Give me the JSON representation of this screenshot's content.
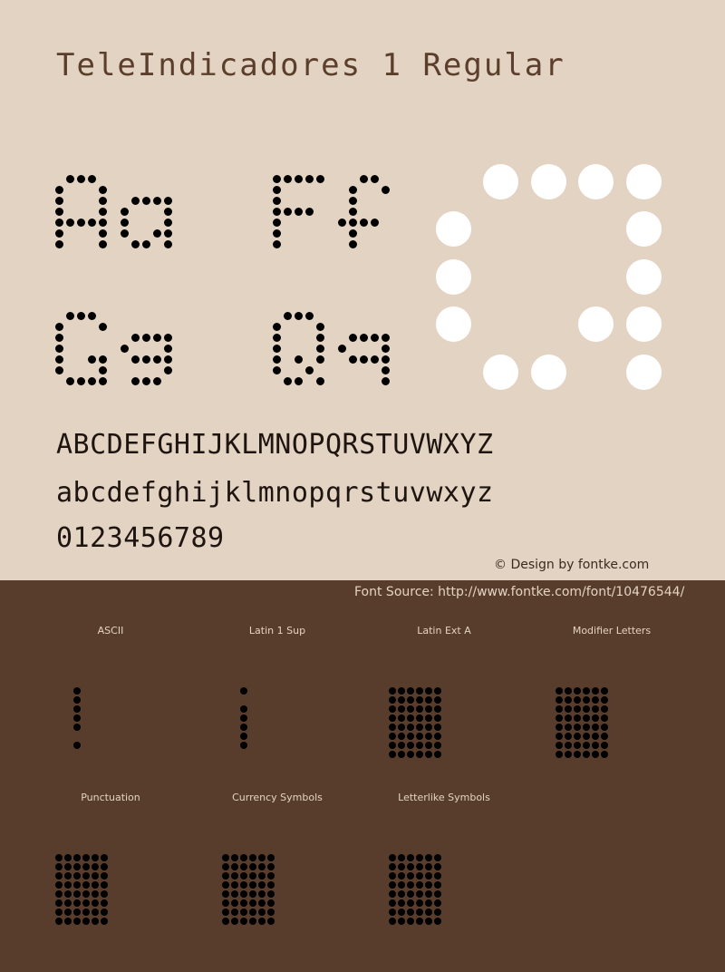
{
  "title": "TeleIndicadores 1 Regular",
  "colors": {
    "background_top": "#e3d3c2",
    "background_bottom": "#583d2c",
    "ink": "#000000",
    "title_ink": "#5b3e2c",
    "highlight_dots": "#ffffff"
  },
  "samples": [
    {
      "name": "sample-Aa",
      "text": "Aa"
    },
    {
      "name": "sample-Ff",
      "text": "Ff"
    },
    {
      "name": "sample-Gg",
      "text": "Gg"
    },
    {
      "name": "sample-Qq",
      "text": "Qq"
    },
    {
      "name": "sample-large-a",
      "text": "a"
    }
  ],
  "alphabet": {
    "uppercase": "ABCDEFGHIJKLMNOPQRSTUVWXYZ",
    "lowercase": "abcdefghijklmnopqrstuvwxyz",
    "digits": "0123456789"
  },
  "credit": "© Design by fontke.com",
  "source": "Font Source: http://www.fontke.com/font/10476544/",
  "blocks": [
    {
      "label": "ASCII",
      "glyph": "!"
    },
    {
      "label": "Latin 1 Sup",
      "glyph": "¡"
    },
    {
      "label": "Latin Ext A",
      "glyph": "missing"
    },
    {
      "label": "Modifier Letters",
      "glyph": "missing"
    },
    {
      "label": "Punctuation",
      "glyph": "missing"
    },
    {
      "label": "Currency Symbols",
      "glyph": "missing"
    },
    {
      "label": "Letterlike Symbols",
      "glyph": "missing"
    }
  ]
}
